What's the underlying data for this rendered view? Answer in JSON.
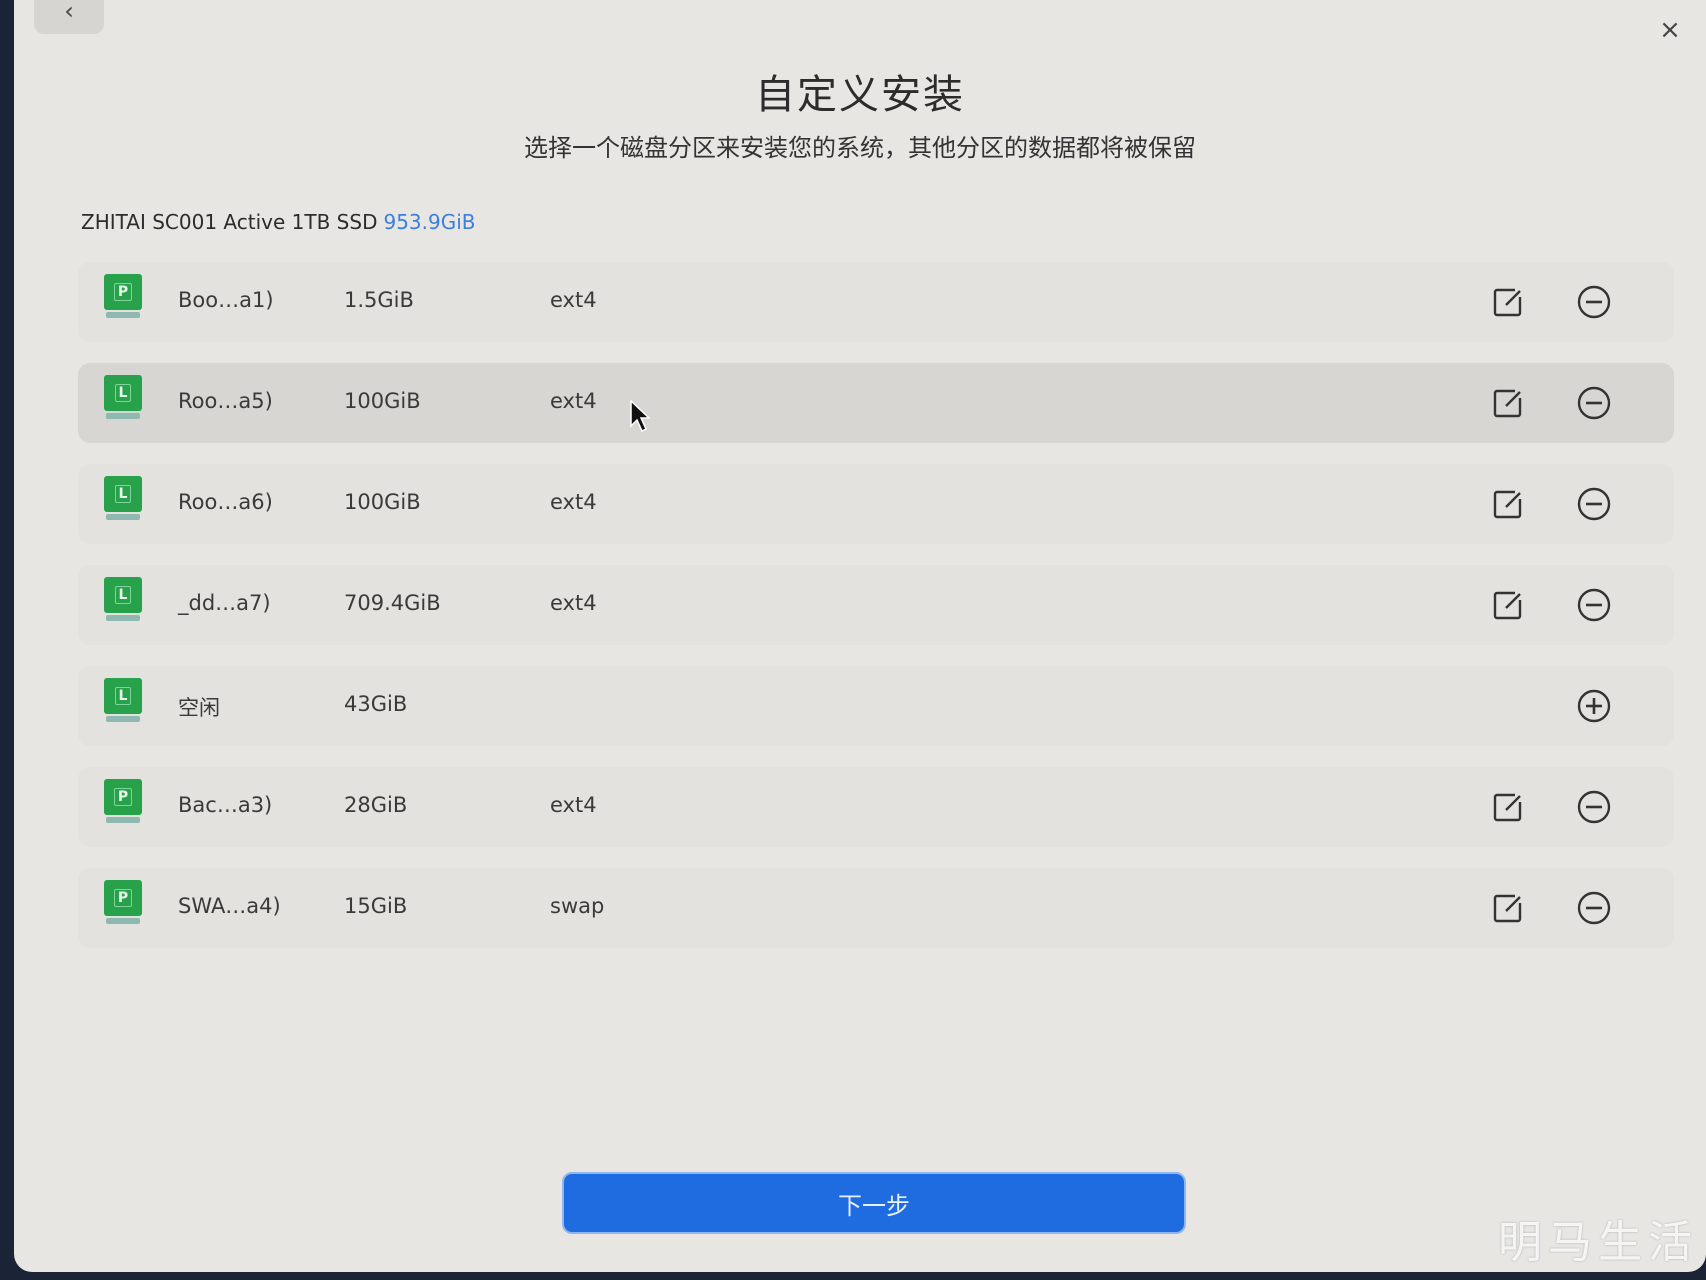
{
  "window": {
    "back_icon": "‹",
    "close_icon": "×",
    "title": "自定义安装",
    "subtitle": "选择一个磁盘分区来安装您的系统，其他分区的数据都将被保留"
  },
  "disk": {
    "name": "ZHITAI SC001 Active 1TB SSD",
    "size": "953.9GiB",
    "size_color": "#3b7fe0"
  },
  "partitions": [
    {
      "type_letter": "P",
      "name": "Boo…a1)",
      "size": "1.5GiB",
      "fs": "ext4",
      "action": "remove"
    },
    {
      "type_letter": "L",
      "name": "Roo…a5)",
      "size": "100GiB",
      "fs": "ext4",
      "action": "remove"
    },
    {
      "type_letter": "L",
      "name": "Roo…a6)",
      "size": "100GiB",
      "fs": "ext4",
      "action": "remove"
    },
    {
      "type_letter": "L",
      "name": "_dd…a7)",
      "size": "709.4GiB",
      "fs": "ext4",
      "action": "remove"
    },
    {
      "type_letter": "L",
      "name": "空闲",
      "size": "43GiB",
      "fs": "",
      "action": "add"
    },
    {
      "type_letter": "P",
      "name": "Bac…a3)",
      "size": "28GiB",
      "fs": "ext4",
      "action": "remove"
    },
    {
      "type_letter": "P",
      "name": "SWA…a4)",
      "size": "15GiB",
      "fs": "swap",
      "action": "remove"
    }
  ],
  "next_button": {
    "label": "下一步",
    "color": "#1f6ce0"
  },
  "watermark": "明马生活",
  "accent_color": "#27a24a"
}
